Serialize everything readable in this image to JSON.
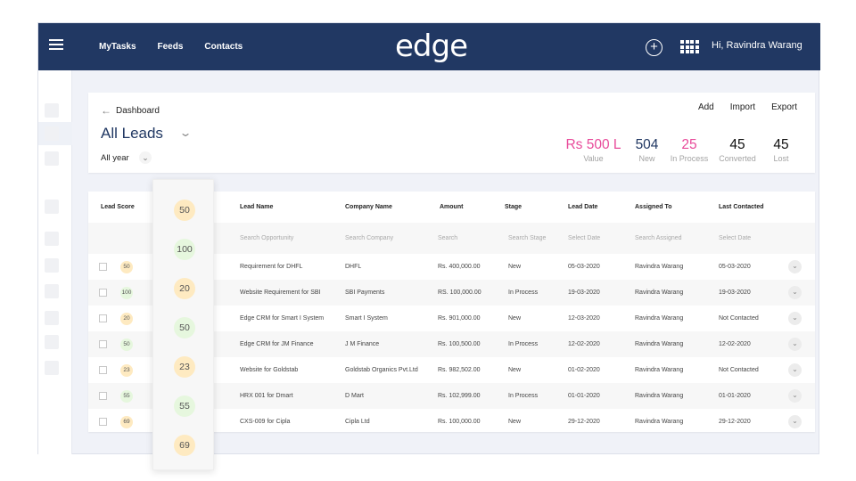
{
  "nav": {
    "links": [
      "MyTasks",
      "Feeds",
      "Contacts"
    ],
    "logo": "edge",
    "greeting": "Hi, Ravindra Warang",
    "icons": [
      "menu-icon",
      "add-circle-icon",
      "apps-grid-icon"
    ]
  },
  "header": {
    "back_label": "Dashboard",
    "back_arrow": "←",
    "title": "All Leads",
    "title_chevron": "⌄",
    "period": "All year",
    "period_chevron": "⌄",
    "actions": [
      "Add",
      "Import",
      "Export"
    ],
    "stats": [
      {
        "value": "Rs 500 L",
        "label": "Value",
        "color": "#e84a9a"
      },
      {
        "value": "504",
        "label": "New",
        "color": "#213863"
      },
      {
        "value": "25",
        "label": "In Process",
        "color": "#e84a9a"
      },
      {
        "value": "45",
        "label": "Converted",
        "color": "#111111"
      },
      {
        "value": "45",
        "label": "Lost",
        "color": "#111111"
      }
    ]
  },
  "table": {
    "columns": [
      "Lead Score",
      "Lead Name",
      "Company Name",
      "Amount",
      "Stage",
      "Lead Date",
      "Assigned To",
      "Last Contacted"
    ],
    "filters": [
      "Search Opportunity",
      "Search Company",
      "Search",
      "Search Stage",
      "Select Date",
      "Search Assigned",
      "Select Date"
    ],
    "rows": [
      {
        "score": "50",
        "score_tone": "yellow",
        "lead": "Requirement for DHFL",
        "company": "DHFL",
        "amount": "Rs. 400,000.00",
        "stage": "New",
        "date": "05-03-2020",
        "assigned": "Ravindra Warang",
        "last": "05-03-2020"
      },
      {
        "score": "100",
        "score_tone": "green",
        "lead": "Website Requirement for SBI",
        "company": "SBI Payments",
        "amount": "RS. 100,000.00",
        "stage": "In Process",
        "date": "19-03-2020",
        "assigned": "Ravindra Warang",
        "last": "19-03-2020"
      },
      {
        "score": "20",
        "score_tone": "yellow",
        "lead": "Edge CRM for Smart I System",
        "company": "Smart I System",
        "amount": "Rs. 901,000.00",
        "stage": "New",
        "date": "12-03-2020",
        "assigned": "Ravindra Warang",
        "last": "Not Contacted"
      },
      {
        "score": "50",
        "score_tone": "green",
        "lead": "Edge CRM for JM Finance",
        "company": "J M Finance",
        "amount": "Rs. 100,500.00",
        "stage": "In Process",
        "date": "12-02-2020",
        "assigned": "Ravindra Warang",
        "last": "12-02-2020"
      },
      {
        "score": "23",
        "score_tone": "yellow",
        "lead": "Website for Goldstab",
        "company": "Goldstab Organics Pvt.Ltd",
        "amount": "Rs. 982,502.00",
        "stage": "New",
        "date": "01-02-2020",
        "assigned": "Ravindra Warang",
        "last": "Not Contacted"
      },
      {
        "score": "55",
        "score_tone": "green",
        "lead": "HRX 001 for Dmart",
        "company": "D Mart",
        "amount": "Rs. 102,999.00",
        "stage": "In Process",
        "date": "01-01-2020",
        "assigned": "Ravindra Warang",
        "last": "01-01-2020"
      },
      {
        "score": "69",
        "score_tone": "yellow",
        "lead": "CXS-009 for Cipla",
        "company": "Cipla Ltd",
        "amount": "Rs. 100,000.00",
        "stage": "New",
        "date": "29-12-2020",
        "assigned": "Ravindra Warang",
        "last": "29-12-2020"
      }
    ],
    "row_chevron": "⌄"
  },
  "floating_scores": [
    {
      "value": "50",
      "tone": "yellow"
    },
    {
      "value": "100",
      "tone": "green"
    },
    {
      "value": "20",
      "tone": "yellow"
    },
    {
      "value": "50",
      "tone": "green"
    },
    {
      "value": "23",
      "tone": "yellow"
    },
    {
      "value": "55",
      "tone": "green"
    },
    {
      "value": "69",
      "tone": "yellow"
    }
  ],
  "colors": {
    "nav_bg": "#213863",
    "accent_pink": "#e84a9a",
    "score_yellow": "#feeac1",
    "score_green": "#e6f7de"
  }
}
